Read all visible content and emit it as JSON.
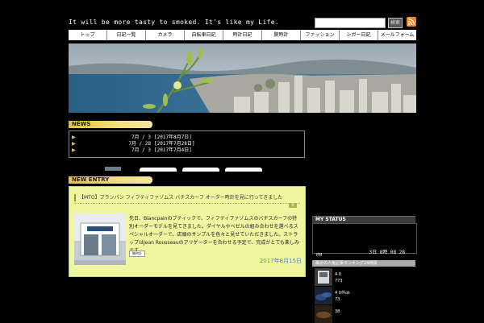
{
  "header": {
    "tagline": "It will be more tasty to smoked. It's like my Life.",
    "search_button": "検索"
  },
  "nav": [
    "トップ",
    "日記一覧",
    "カメラ",
    "自転車日記",
    "時計日記",
    "腕時計",
    "ファッション",
    "シガー日記",
    "メールフォーム"
  ],
  "news": {
    "heading": "NEWS",
    "rows": [
      {
        "date": "7月 / 3",
        "title": "[2017年8月7日]"
      },
      {
        "date": "7月 / 28",
        "title": "[2017年7月28日]"
      },
      {
        "date": "7月 / 3",
        "title": "[2017年7月4日]"
      }
    ]
  },
  "entry": {
    "heading": "NEW ENTRY",
    "title": "【MTO】ブランパン フィフティファゾムス バチスカーフ オーダー時計を見に行ってきました",
    "comment_count": "0",
    "body": "先日、Blancpainのブティックで、フィフティファゾムスのバチスカーフの特別オーダーモデルを見てきました。ダイヤルやベゼルの組み合わせを選べるスペシャルオーダーで、店頭のサンプルを色々と見せていただきました。ストラップはJean Rousseauのアリゲーターを合わせる予定で、完成がとても楽しみです。",
    "tag": "腕時計",
    "date": "2017年8月15日"
  },
  "sidebar": {
    "status_heading": "MY STATUS",
    "status_time": "3日 8時 08 28",
    "status_small": "PM",
    "list_heading": "最近の人気記事ランキング24時間",
    "list": [
      {
        "line1": "4  0",
        "line2": "773"
      },
      {
        "line1": "4  0件ok",
        "line2": "73"
      },
      {
        "line1": "",
        "line2": "38"
      }
    ]
  }
}
